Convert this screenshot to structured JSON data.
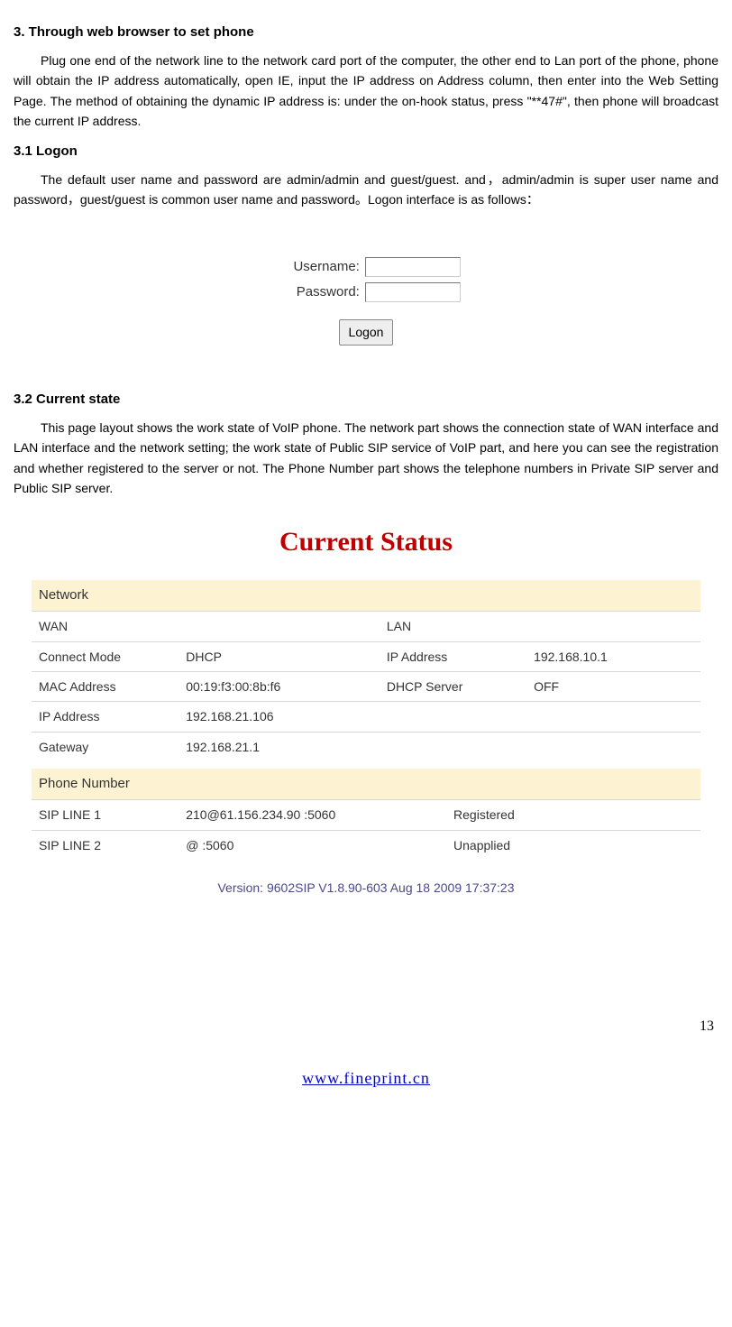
{
  "heading_main": "3. Through web browser to set phone",
  "para_main": "Plug one end of the network line to the network card port of the computer, the other end to Lan port of the phone, phone will obtain the IP address automatically, open IE, input the IP address on Address column, then enter into the Web Setting Page. The method of obtaining the dynamic IP address is: under the on-hook status, press \"**47#\", then phone will broadcast the current IP address.",
  "heading_31": "3.1 Logon",
  "para_31": "The default user name and password are admin/admin and guest/guest. and，admin/admin is super user name and password，guest/guest is common user name and password。Logon interface is as follows：",
  "logon": {
    "username_label": "Username:",
    "password_label": "Password:",
    "button": "Logon"
  },
  "heading_32": "3.2 Current state",
  "para_32": "This page layout shows the work state of VoIP phone. The network part shows the connection state of WAN interface and LAN interface and the network setting; the work state of Public SIP service of VoIP part, and here you can see the registration and whether registered to the server or not. The Phone Number part shows the telephone numbers in Private SIP server and Public SIP server.",
  "status_title": "Current Status",
  "network": {
    "section": "Network",
    "wan_label": "WAN",
    "lan_label": "LAN",
    "connect_mode_label": "Connect Mode",
    "connect_mode_value": "DHCP",
    "ip_address_label": "IP Address",
    "lan_ip_value": "192.168.10.1",
    "mac_label": "MAC Address",
    "mac_value": "00:19:f3:00:8b:f6",
    "dhcp_server_label": "DHCP Server",
    "dhcp_server_value": "OFF",
    "wan_ip_label": "IP Address",
    "wan_ip_value": "192.168.21.106",
    "gateway_label": "Gateway",
    "gateway_value": "192.168.21.1"
  },
  "phone": {
    "section": "Phone Number",
    "line1_label": "SIP LINE 1",
    "line1_value": "210@61.156.234.90 :5060",
    "line1_status": "Registered",
    "line2_label": "SIP LINE 2",
    "line2_value": "@ :5060",
    "line2_status": "Unapplied"
  },
  "version": "Version: 9602SIP V1.8.90-603 Aug 18 2009 17:37:23",
  "page_number": "13",
  "footer_link": "www.fineprint.cn"
}
